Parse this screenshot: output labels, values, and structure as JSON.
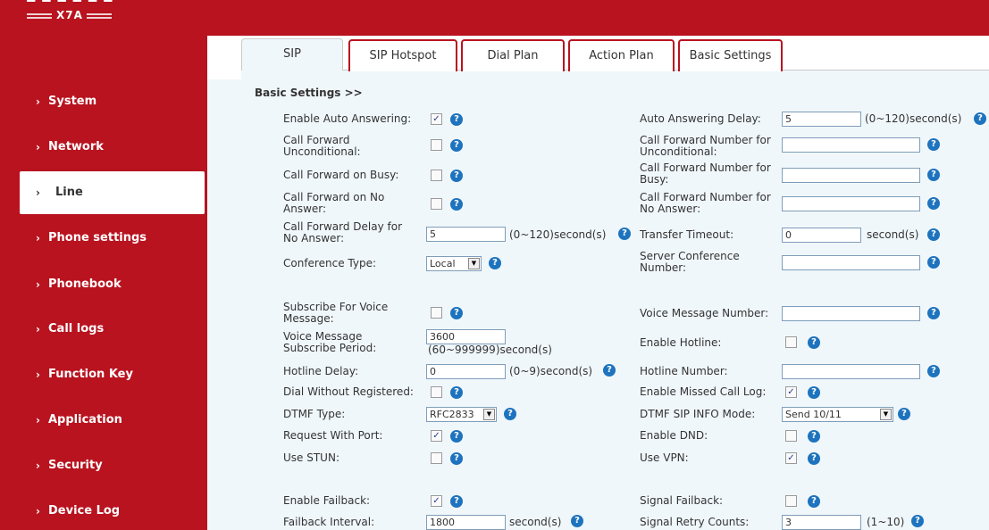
{
  "header": {
    "logo_model": "X7A",
    "logo_top": "FANVIL"
  },
  "sidebar": {
    "items": [
      {
        "label": "System"
      },
      {
        "label": "Network"
      },
      {
        "label": "Line"
      },
      {
        "label": "Phone settings"
      },
      {
        "label": "Phonebook"
      },
      {
        "label": "Call logs"
      },
      {
        "label": "Function Key"
      },
      {
        "label": "Application"
      },
      {
        "label": "Security"
      },
      {
        "label": "Device Log"
      }
    ],
    "active": "Line"
  },
  "tabs": [
    {
      "label": "SIP"
    },
    {
      "label": "SIP Hotspot"
    },
    {
      "label": "Dial Plan"
    },
    {
      "label": "Action Plan"
    },
    {
      "label": "Basic Settings"
    }
  ],
  "section_title": "Basic Settings >>",
  "form": {
    "enable_auto_answering": {
      "label": "Enable Auto Answering:",
      "checked": true
    },
    "auto_answering_delay": {
      "label": "Auto Answering Delay:",
      "value": "5",
      "unit": "(0~120)second(s)"
    },
    "cf_unconditional": {
      "label1": "Call Forward",
      "label2": "Unconditional:",
      "checked": false
    },
    "cf_number_unconditional": {
      "label1": "Call Forward Number for",
      "label2": "Unconditional:",
      "value": ""
    },
    "cf_busy": {
      "label": "Call Forward on Busy:",
      "checked": false
    },
    "cf_number_busy": {
      "label1": "Call Forward Number for",
      "label2": "Busy:",
      "value": ""
    },
    "cf_no_answer": {
      "label1": "Call Forward on No",
      "label2": "Answer:",
      "checked": false
    },
    "cf_number_no_answer": {
      "label1": "Call Forward Number for",
      "label2": "No Answer:",
      "value": ""
    },
    "cf_delay_no_answer": {
      "label1": "Call Forward Delay for",
      "label2": "No Answer:",
      "value": "5",
      "unit": "(0~120)second(s)"
    },
    "transfer_timeout": {
      "label": "Transfer Timeout:",
      "value": "0",
      "unit": "second(s)"
    },
    "conference_type": {
      "label": "Conference Type:",
      "value": "Local"
    },
    "server_conference_number": {
      "label1": "Server Conference",
      "label2": "Number:",
      "value": ""
    },
    "subscribe_voice_message": {
      "label1": "Subscribe For Voice",
      "label2": "Message:",
      "checked": false
    },
    "voice_message_number": {
      "label": "Voice Message Number:",
      "value": ""
    },
    "voice_message_subscribe_period": {
      "label1": "Voice Message",
      "label2": "Subscribe Period:",
      "value": "3600",
      "unit": "(60~999999)second(s)"
    },
    "enable_hotline": {
      "label": "Enable Hotline:",
      "checked": false
    },
    "hotline_delay": {
      "label": "Hotline Delay:",
      "value": "0",
      "unit": "(0~9)second(s)"
    },
    "hotline_number": {
      "label": "Hotline Number:",
      "value": ""
    },
    "dial_without_registered": {
      "label": "Dial Without Registered:",
      "checked": false
    },
    "enable_missed_call_log": {
      "label": "Enable Missed Call Log:",
      "checked": true
    },
    "dtmf_type": {
      "label": "DTMF Type:",
      "value": "RFC2833"
    },
    "dtmf_sip_info_mode": {
      "label": "DTMF SIP INFO Mode:",
      "value": "Send 10/11"
    },
    "request_with_port": {
      "label": "Request With Port:",
      "checked": true
    },
    "enable_dnd": {
      "label": "Enable DND:",
      "checked": false
    },
    "use_stun": {
      "label": "Use STUN:",
      "checked": false
    },
    "use_vpn": {
      "label": "Use VPN:",
      "checked": true
    },
    "enable_failback": {
      "label": "Enable Failback:",
      "checked": true
    },
    "signal_failback": {
      "label": "Signal Failback:",
      "checked": false
    },
    "failback_interval": {
      "label": "Failback Interval:",
      "value": "1800",
      "unit": "second(s)"
    },
    "signal_retry_counts": {
      "label": "Signal Retry Counts:",
      "value": "3",
      "unit": "(1~10)"
    }
  },
  "colors": {
    "brand": "#b8131f",
    "panel": "#f0f7fb",
    "help": "#1e73be"
  },
  "icons": {
    "help": "help-icon",
    "chevron": "chevron-right-icon",
    "dropdown": "dropdown-arrow-icon"
  }
}
